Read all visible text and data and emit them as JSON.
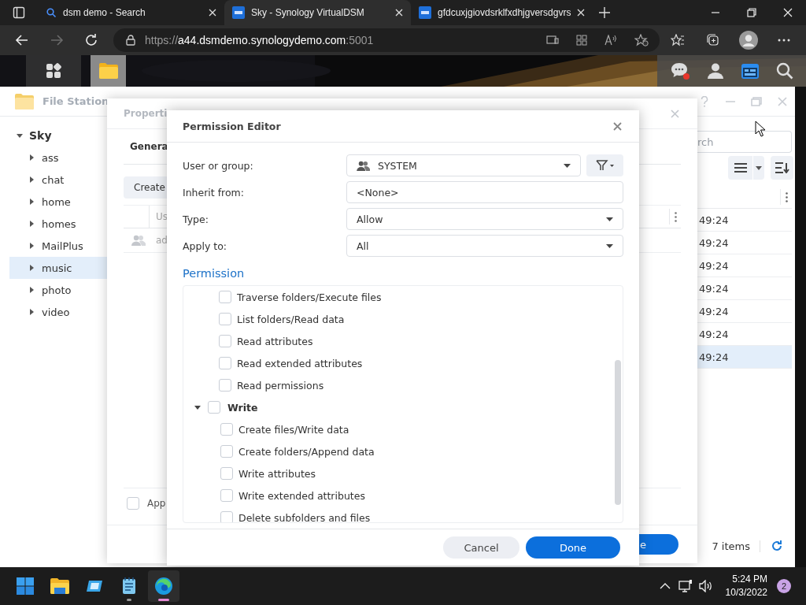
{
  "browser": {
    "tabs": [
      {
        "title": "dsm demo - Search",
        "kind": "search",
        "selected": false
      },
      {
        "title": "Sky - Synology VirtualDSM",
        "kind": "dsm",
        "selected": true
      },
      {
        "title": "gfdcuxjgiovdsrklfxdhjgversdgvrs",
        "kind": "dsm",
        "selected": false
      }
    ],
    "nav": [
      {
        "kind": "back",
        "disabled": false
      },
      {
        "kind": "forward",
        "disabled": true
      },
      {
        "kind": "refresh",
        "disabled": false
      }
    ],
    "address": {
      "scheme": "https://",
      "host": "a44.dsmdemo.synologydemo.com",
      "port": ":5001"
    }
  },
  "dsm_bar": {
    "apps": [
      {
        "kind": "main-menu",
        "selected": false
      },
      {
        "kind": "file-station",
        "selected": true
      }
    ],
    "chat_unread": true
  },
  "file_station": {
    "title": "File Station",
    "tree": {
      "label": "Sky",
      "expanded": true,
      "children": [
        {
          "label": "ass",
          "selected": false
        },
        {
          "label": "chat",
          "selected": false
        },
        {
          "label": "home",
          "selected": false
        },
        {
          "label": "homes",
          "selected": false
        },
        {
          "label": "MailPlus",
          "selected": false
        },
        {
          "label": "music",
          "selected": true
        },
        {
          "label": "photo",
          "selected": false
        },
        {
          "label": "video",
          "selected": false
        }
      ]
    },
    "search": {
      "placeholder": "rch"
    },
    "rows": [
      {
        "column_1": "49:24",
        "selected": false
      },
      {
        "column_1": "49:24",
        "selected": false
      },
      {
        "column_1": "49:24",
        "selected": false
      },
      {
        "column_1": "49:24",
        "selected": false
      },
      {
        "column_1": "49:24",
        "selected": false
      },
      {
        "column_1": "49:24",
        "selected": false
      },
      {
        "column_1": "49:24",
        "selected": true
      }
    ],
    "status": "7 items"
  },
  "properties": {
    "title": "Properti",
    "tab": "Genera",
    "create_button": "Create",
    "column_1": "Us",
    "rows": [
      {
        "column_1": "ad"
      }
    ],
    "apply_checkbox": {
      "label": "App",
      "checked": false
    },
    "primary_button": "e"
  },
  "permission_editor": {
    "title": "Permission Editor",
    "fields": [
      {
        "label": "User or group:",
        "kind": "user-select",
        "value": "SYSTEM"
      },
      {
        "label": "Inherit from:",
        "kind": "text",
        "value": "<None>"
      },
      {
        "label": "Type:",
        "kind": "select",
        "value": "Allow"
      },
      {
        "label": "Apply to:",
        "kind": "select",
        "value": "All"
      }
    ],
    "section": "Permission",
    "permissions": [
      {
        "kind": "item",
        "label": "Traverse folders/Execute files",
        "checked": false
      },
      {
        "kind": "item",
        "label": "List folders/Read data",
        "checked": false
      },
      {
        "kind": "item",
        "label": "Read attributes",
        "checked": false
      },
      {
        "kind": "item",
        "label": "Read extended attributes",
        "checked": false
      },
      {
        "kind": "item",
        "label": "Read permissions",
        "checked": false
      },
      {
        "kind": "group",
        "label": "Write",
        "checked": false,
        "expanded": true,
        "children": [
          {
            "label": "Create files/Write data",
            "checked": false
          },
          {
            "label": "Create folders/Append data",
            "checked": false
          },
          {
            "label": "Write attributes",
            "checked": false
          },
          {
            "label": "Write extended attributes",
            "checked": false
          },
          {
            "label": "Delete subfolders and files",
            "checked": false
          }
        ]
      }
    ],
    "buttons": [
      {
        "label": "Cancel",
        "kind": "secondary"
      },
      {
        "label": "Done",
        "kind": "primary"
      }
    ]
  },
  "taskbar": {
    "apps": [
      {
        "kind": "explorer",
        "selected": false,
        "running": false
      },
      {
        "kind": "app",
        "selected": false,
        "running": false
      },
      {
        "kind": "notepad",
        "selected": false,
        "running": true
      },
      {
        "kind": "edge",
        "selected": true,
        "running": true
      }
    ],
    "time": "5:24 PM",
    "date": "10/3/2022",
    "badge": "2"
  }
}
